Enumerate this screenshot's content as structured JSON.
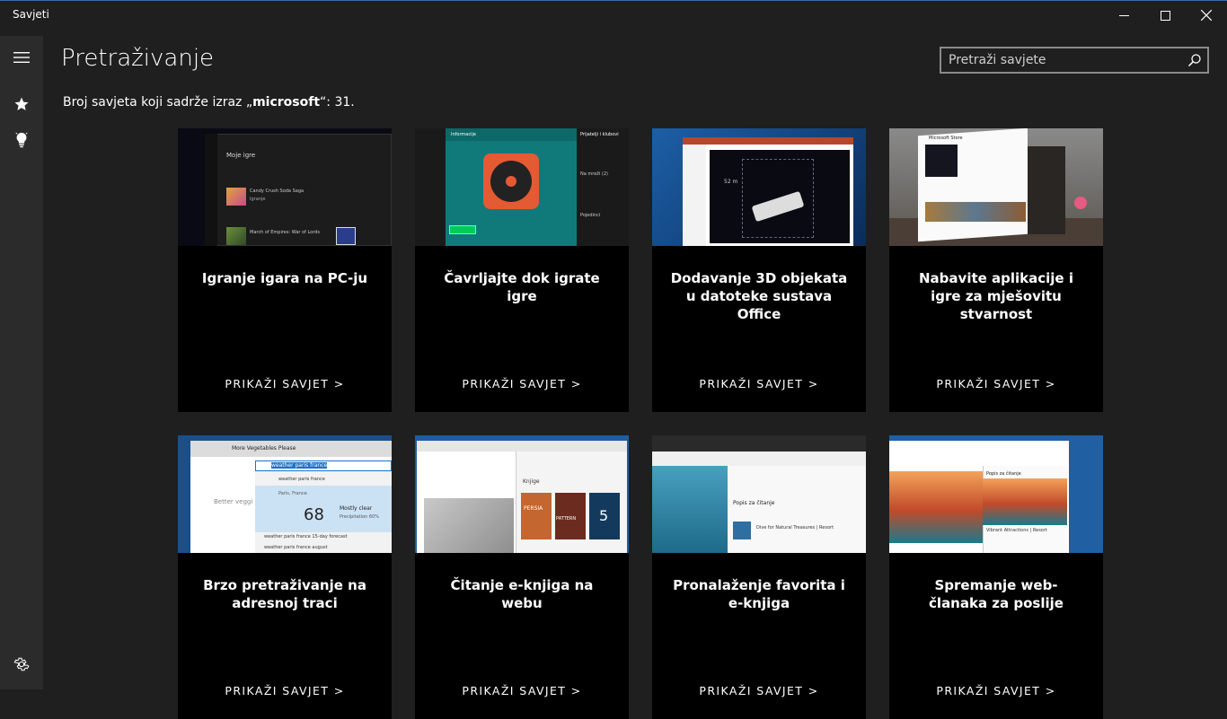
{
  "window": {
    "title": "Savjeti"
  },
  "header": {
    "page_title": "Pretraživanje"
  },
  "search": {
    "placeholder": "Pretraži savjete"
  },
  "results": {
    "prefix": "Broj savjeta koji sadrže izraz „",
    "term": "microsoft",
    "suffix": "“: 31."
  },
  "icons": {
    "menu": "hamburger-icon",
    "favorites": "star-icon",
    "tips": "lightbulb-icon",
    "settings": "gear-icon",
    "search": "search-icon"
  },
  "cards": [
    {
      "title": "Igranje igara na PC-ju",
      "link": "PRIKAŽI SAVJET >",
      "thumb": {
        "heading": "Moje igre",
        "item1": "Candy Crush Soda Saga",
        "item2": "March of Empires: War of Lords",
        "action": "Igranje"
      }
    },
    {
      "title": "Čavrljajte dok igrate igre",
      "link": "PRIKAŽI SAVJET >",
      "thumb": {
        "tab": "Informacije",
        "panel": "Prijatelji i klubovi",
        "online": "Na mreži (2)",
        "clubs": "Pojedinci"
      }
    },
    {
      "title": "Dodavanje 3D objekata u datoteke sustava Office",
      "link": "PRIKAŽI SAVJET >",
      "thumb": {
        "dim": "52 m"
      }
    },
    {
      "title": "Nabavite aplikacije i igre za mješovitu stvarnost",
      "link": "PRIKAŽI SAVJET >",
      "thumb": {
        "store": "Microsoft Store"
      }
    },
    {
      "title": "Brzo pretraživanje na adresnoj traci",
      "link": "PRIKAŽI SAVJET >",
      "thumb": {
        "tab": "More Vegetables Please",
        "query": "weather paris france",
        "city": "Paris, France",
        "temp": "68",
        "condition": "Mostly clear",
        "precip": "Precipitation 60%",
        "sugg1": "weather paris france 15-day forecast",
        "sugg2": "weather paris france august",
        "page": "Better veggi"
      }
    },
    {
      "title": "Čitanje e-knjiga na webu",
      "link": "PRIKAŽI SAVJET >",
      "thumb": {
        "books": "Knjige",
        "book1": "PERSIA",
        "book2": "PATTERN",
        "book3": "5"
      }
    },
    {
      "title": "Pronalaženje favorita i e-knjiga",
      "link": "PRIKAŽI SAVJET >",
      "thumb": {
        "panel": "Popis za čitanje",
        "item": "Dive for Natural Treasures | Resort"
      }
    },
    {
      "title": "Spremanje web-članaka za poslije",
      "link": "PRIKAŽI SAVJET >",
      "thumb": {
        "panel": "Popis za čitanje",
        "item": "Vibrant Attractions | Resort"
      }
    }
  ]
}
